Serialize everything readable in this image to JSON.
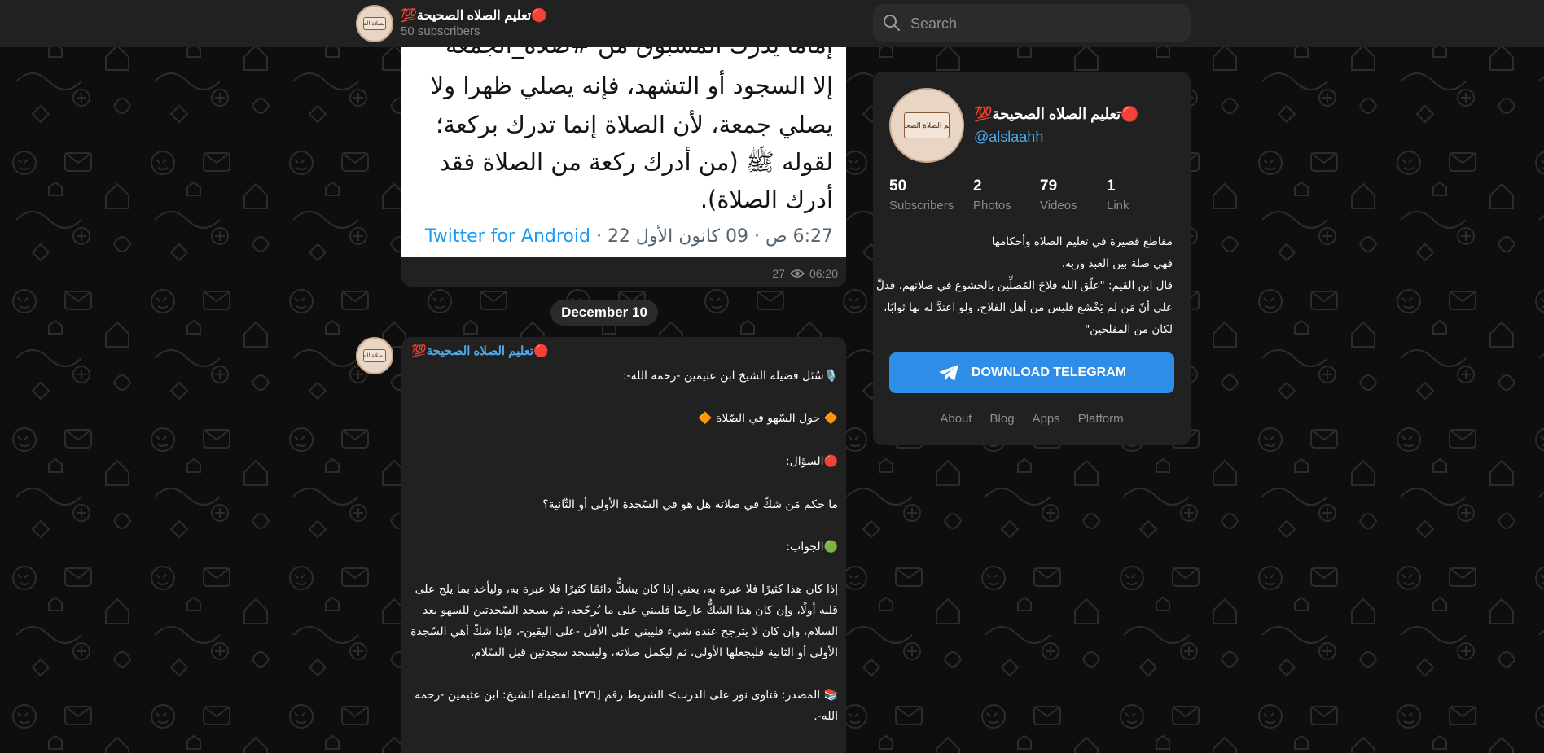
{
  "header": {
    "channel_name": "🔴تعليم الصلاه الصحيحة💯",
    "subscribers": "50 subscribers",
    "avatar_text": "تعليم الصلاة الصحيحة"
  },
  "search": {
    "placeholder": "Search"
  },
  "post1": {
    "tweet_lines": [
      "إماما يدرك المسبوق من #صلاة_الجمعة",
      "إلا السجود أو التشهد، فإنه يصلي ظهرا ولا",
      "يصلي جمعة، لأن الصلاة إنما تدرك بركعة؛",
      "لقوله ﷺ (من أدرك ركعة من الصلاة فقد",
      "أدرك الصلاة)."
    ],
    "tweet_time": "6:27 ص · 09 كانون الأول 22 · ",
    "tweet_source": "Twitter for Android",
    "views": "27",
    "time": "06:20"
  },
  "date_divider": "December 10",
  "post2": {
    "author": "🔴تعليم الصلاه الصحيحة💯",
    "lines": [
      "🎙️سُئل فضيلة الشيخ ابن عثيمين -رحمه الله-:",
      "🔶 حول السّهو في الصّلاة 🔶",
      "🔴السؤال:",
      "ما حكم مَن شكّ في صلاته هل هو في السّجدة الأولى أو الثّانية؟",
      "🟢الجواب:",
      "إذا كان هذا كثيرًا فلا عبرة به، يعني إذا كان يشكُّ دائمًا كثيرًا فلا عبرة به، وليأخذ بما يلج على",
      "قلبه أولًا، وإن كان هذا الشكُّ عارضًا فليبني على ما يُرجّحه، ثم يسجد السّجدتين للسهو بعد",
      "السلام، وإن كان لا يترجح عنده شيء فليبني على الأقل -على اليقين-، فإذا شكّ أهي السّجدة",
      "الأولى أو الثانية فليجعلها الأولى، ثم ليكمل صلاته، وليسجد سجدتين قبل السّلام.",
      "📚 المصدر: فتاوى نور على الدرب> الشريط رقم [٣٧٦] لفضيلة الشيخ: ابن عثيمين -رحمه",
      "الله-."
    ]
  },
  "profile": {
    "name": "🔴تعليم الصلاه الصحيحة💯",
    "handle": "@alslaahh",
    "avatar_text": "تعليم الصلاة الصحيحة",
    "stats": [
      {
        "num": "50",
        "label": "Subscribers"
      },
      {
        "num": "2",
        "label": "Photos"
      },
      {
        "num": "79",
        "label": "Videos"
      },
      {
        "num": "1",
        "label": "Link"
      }
    ],
    "description": [
      "مقاطع قصيرة في تعليم الصلاه وأحكامها",
      "فهي صلة بين العبد وربه.",
      "قال ابن القيم: \"علّق الله فلاحَ المُصلِّين بالخشوع في صلاتهم، فدلَّ",
      "على أنّ مَن لم يَخْشع فليس من أهل الفلاح، ولو اعتدَّ له بها ثوابًا،",
      "لكان من المفلحين\""
    ],
    "download_label": "DOWNLOAD TELEGRAM",
    "links": [
      "About",
      "Blog",
      "Apps",
      "Platform"
    ]
  },
  "colors": {
    "accent": "#2e8de6",
    "link": "#4fa9e8",
    "panel": "#212121",
    "background": "#0e0e0e"
  }
}
